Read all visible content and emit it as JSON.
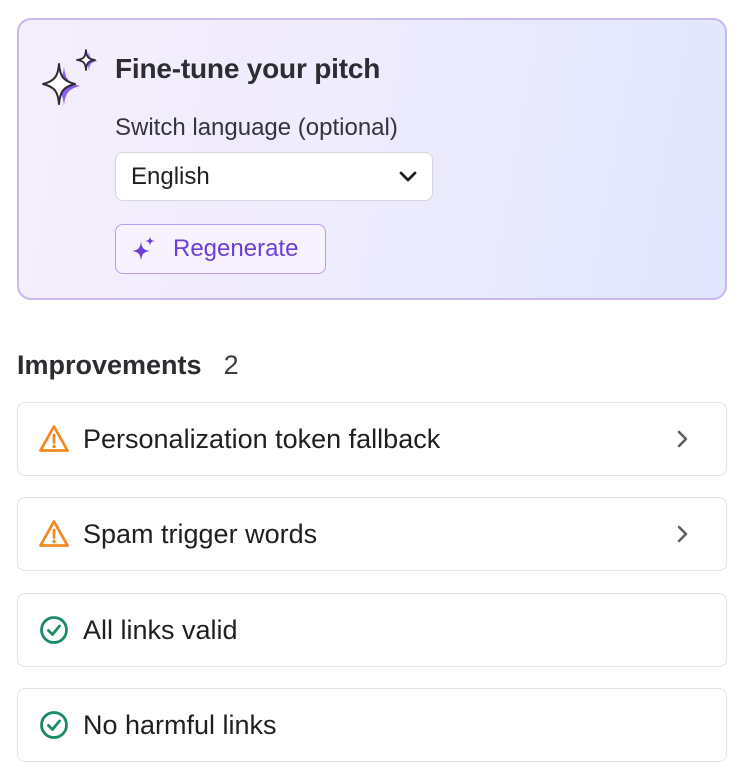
{
  "tune": {
    "title": "Fine-tune your pitch",
    "language_label": "Switch language (optional)",
    "language_value": "English",
    "regenerate_label": "Regenerate",
    "accent_color": "#6d3fd6"
  },
  "improvements": {
    "title": "Improvements",
    "count": "2",
    "items": [
      {
        "label": "Personalization token fallback",
        "status": "warning",
        "icon": "warning-icon",
        "color": "#f08a24"
      },
      {
        "label": "Spam trigger words",
        "status": "warning",
        "icon": "warning-icon",
        "color": "#f08a24"
      },
      {
        "label": "All links valid",
        "status": "success",
        "icon": "check-circle-icon",
        "color": "#1a8a6b"
      },
      {
        "label": "No harmful links",
        "status": "success",
        "icon": "check-circle-icon",
        "color": "#1a8a6b"
      }
    ]
  }
}
